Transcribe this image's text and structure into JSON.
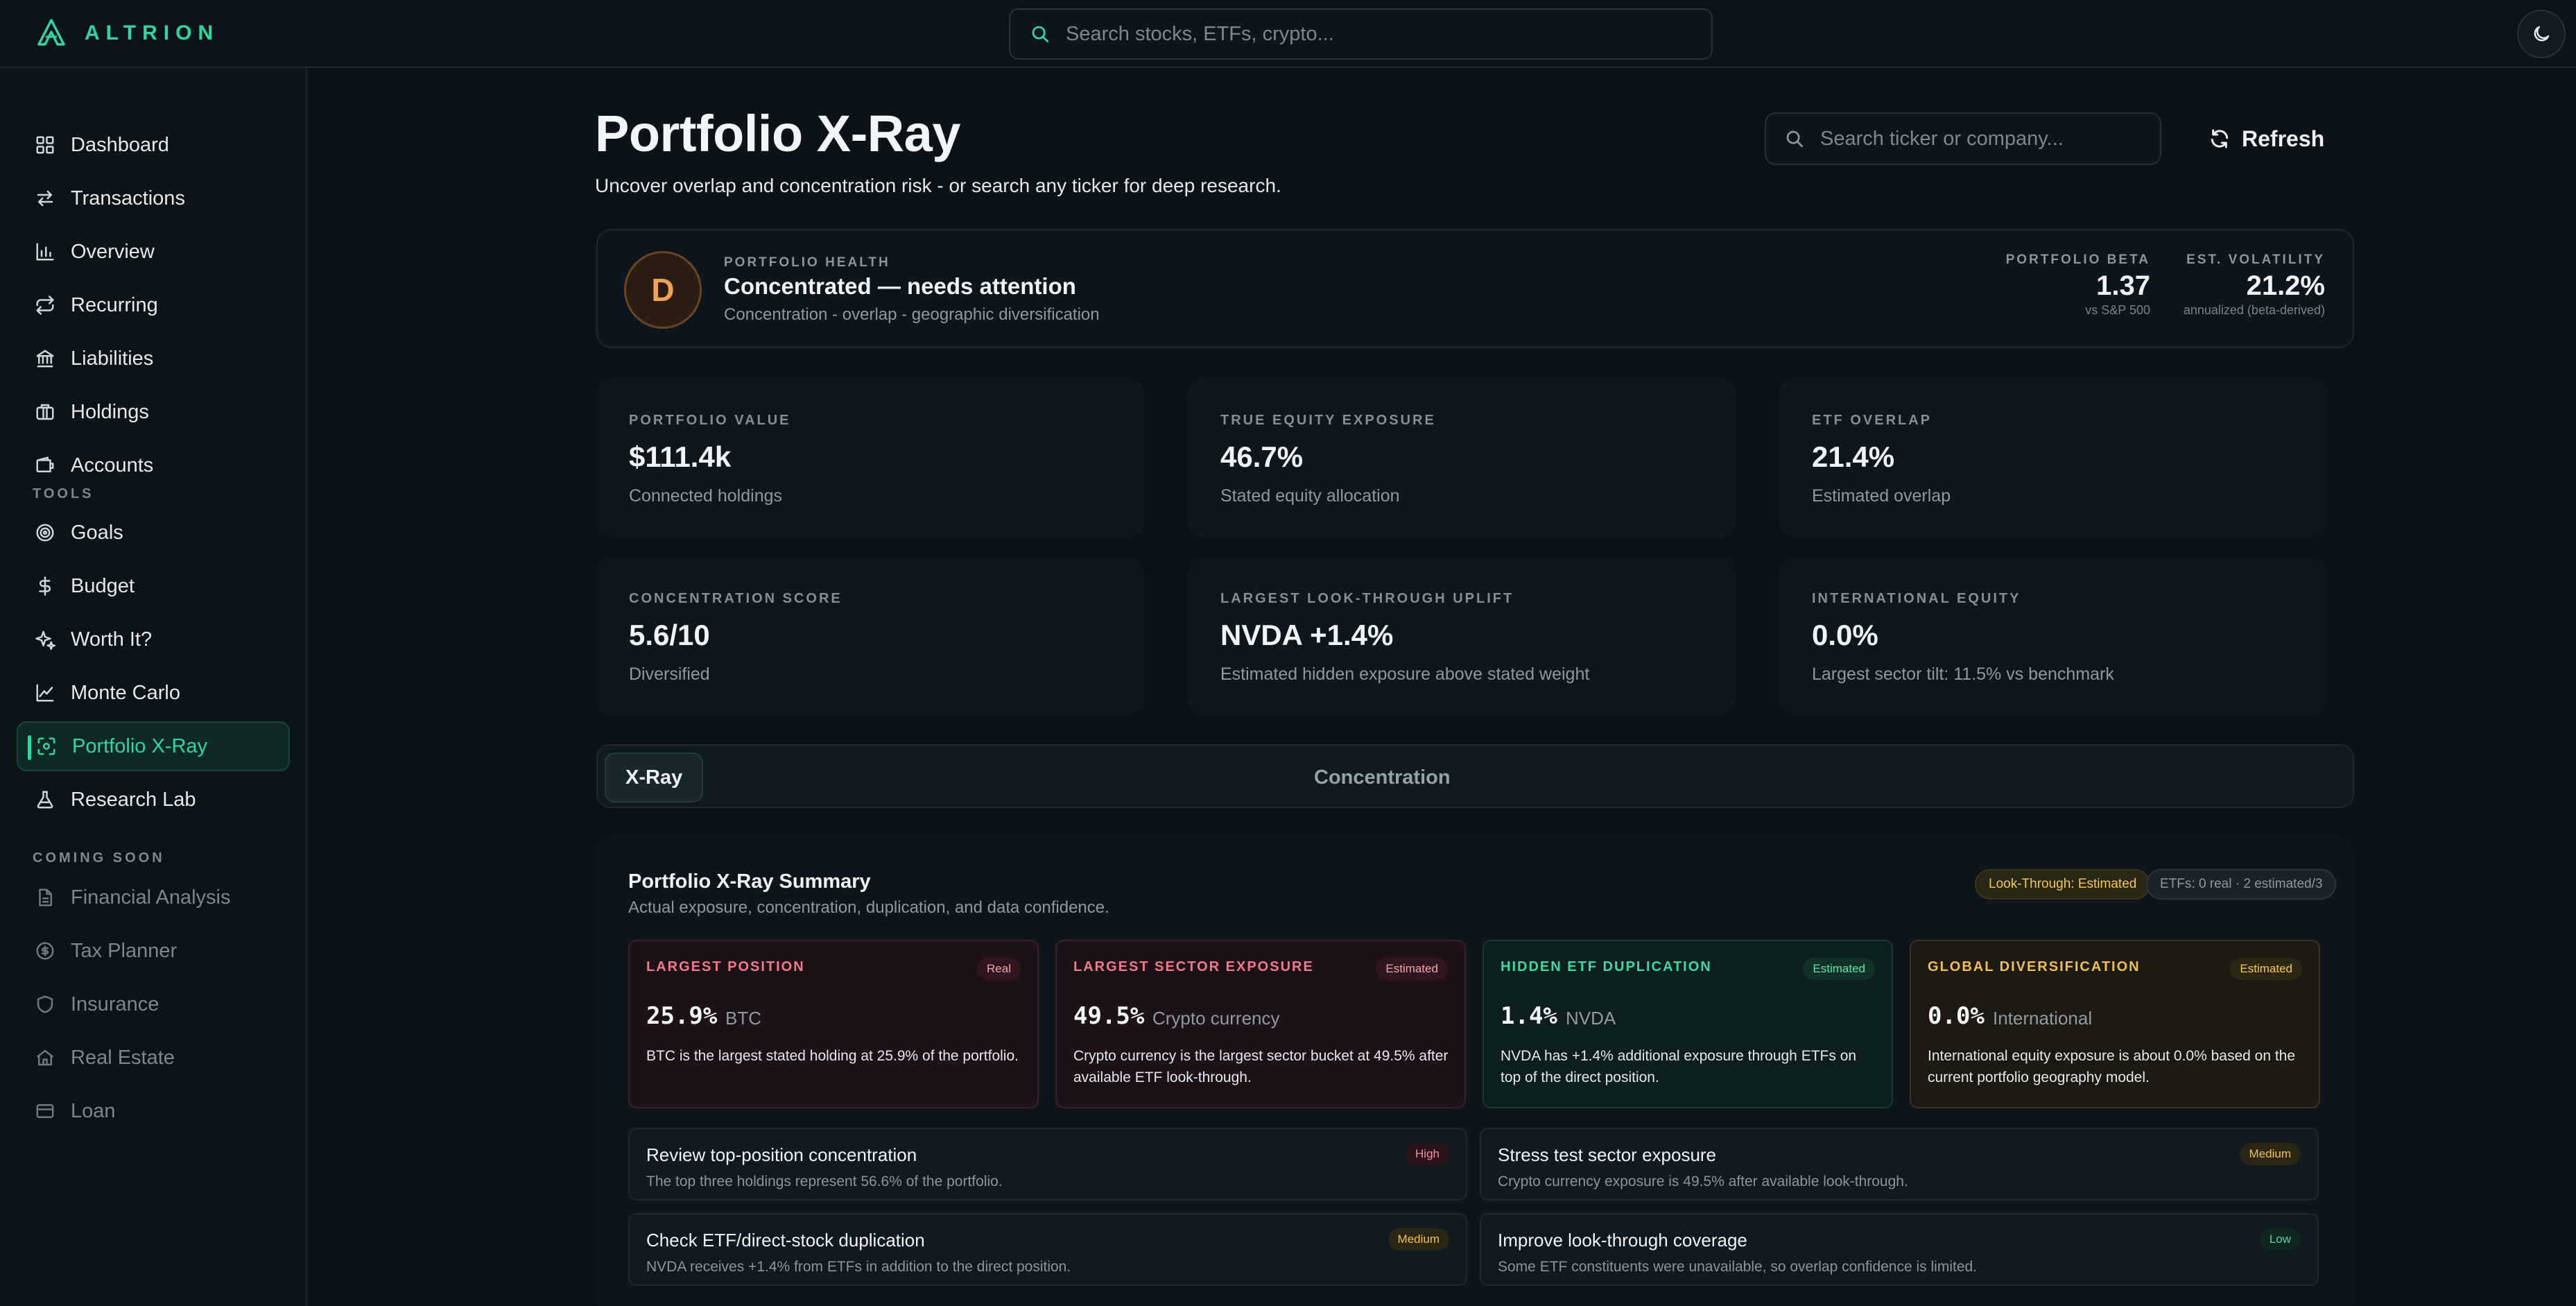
{
  "brand": {
    "name": "ALTRION"
  },
  "global_search": {
    "placeholder": "Search stocks, ETFs, crypto..."
  },
  "sidebar": {
    "items": [
      {
        "label": "Dashboard",
        "icon": "grid-icon"
      },
      {
        "label": "Transactions",
        "icon": "arrows-icon"
      },
      {
        "label": "Overview",
        "icon": "bar-chart-icon"
      },
      {
        "label": "Recurring",
        "icon": "repeat-icon"
      },
      {
        "label": "Liabilities",
        "icon": "bank-icon"
      },
      {
        "label": "Holdings",
        "icon": "briefcase-icon"
      },
      {
        "label": "Accounts",
        "icon": "wallet-icon"
      }
    ],
    "tools_heading": "TOOLS",
    "tools": [
      {
        "label": "Goals",
        "icon": "target-icon"
      },
      {
        "label": "Budget",
        "icon": "dollar-icon"
      },
      {
        "label": "Worth It?",
        "icon": "sparkle-icon"
      },
      {
        "label": "Monte Carlo",
        "icon": "line-chart-icon"
      },
      {
        "label": "Portfolio X-Ray",
        "icon": "scan-icon",
        "active": true
      },
      {
        "label": "Research Lab",
        "icon": "flask-icon"
      }
    ],
    "coming_heading": "COMING SOON",
    "coming": [
      {
        "label": "Financial Analysis",
        "icon": "file-icon"
      },
      {
        "label": "Tax Planner",
        "icon": "coin-icon"
      },
      {
        "label": "Insurance",
        "icon": "shield-icon"
      },
      {
        "label": "Real Estate",
        "icon": "home-icon"
      },
      {
        "label": "Loan",
        "icon": "card-icon"
      }
    ]
  },
  "header": {
    "title": "Portfolio X-Ray",
    "subtitle": "Uncover overlap and concentration risk - or search any ticker for deep research.",
    "ticker_search_placeholder": "Search ticker or company...",
    "refresh_label": "Refresh"
  },
  "health": {
    "grade": "D",
    "eyebrow": "PORTFOLIO HEALTH",
    "title": "Concentrated — needs attention",
    "desc": "Concentration - overlap - geographic diversification",
    "beta": {
      "label": "PORTFOLIO BETA",
      "value": "1.37",
      "sub": "vs S&P 500"
    },
    "volatility": {
      "label": "EST. VOLATILITY",
      "value": "21.2%",
      "sub": "annualized (beta-derived)"
    }
  },
  "stats": [
    {
      "label": "PORTFOLIO VALUE",
      "value": "$111.4k",
      "sub": "Connected holdings"
    },
    {
      "label": "TRUE EQUITY EXPOSURE",
      "value": "46.7%",
      "sub": "Stated equity allocation"
    },
    {
      "label": "ETF OVERLAP",
      "value": "21.4%",
      "sub": "Estimated overlap"
    },
    {
      "label": "CONCENTRATION SCORE",
      "value": "5.6/10",
      "sub": "Diversified"
    },
    {
      "label": "LARGEST LOOK-THROUGH UPLIFT",
      "value": "NVDA +1.4%",
      "sub": "Estimated hidden exposure above stated weight"
    },
    {
      "label": "INTERNATIONAL EQUITY",
      "value": "0.0%",
      "sub": "Largest sector tilt: 11.5% vs benchmark"
    }
  ],
  "tabs": [
    {
      "label": "X-Ray",
      "active": true
    },
    {
      "label": "Concentration",
      "active": false
    }
  ],
  "summary": {
    "title": "Portfolio X-Ray Summary",
    "desc": "Actual exposure, concentration, duplication, and data confidence.",
    "pill_lookthrough": "Look-Through: Estimated",
    "pill_etfs": "ETFs: 0 real · 2 estimated/3",
    "insights": [
      {
        "label": "LARGEST POSITION",
        "badge": "Real",
        "value": "25.9%",
        "unit": "BTC",
        "body": "BTC is the largest stated holding at 25.9% of the portfolio.",
        "tone": "red"
      },
      {
        "label": "LARGEST SECTOR EXPOSURE",
        "badge": "Estimated",
        "value": "49.5%",
        "unit": "Crypto currency",
        "body": "Crypto currency is the largest sector bucket at 49.5% after available ETF look-through.",
        "tone": "red"
      },
      {
        "label": "HIDDEN ETF DUPLICATION",
        "badge": "Estimated",
        "value": "1.4%",
        "unit": "NVDA",
        "body": "NVDA has +1.4% additional exposure through ETFs on top of the direct position.",
        "tone": "green"
      },
      {
        "label": "GLOBAL DIVERSIFICATION",
        "badge": "Estimated",
        "value": "0.0%",
        "unit": "International",
        "body": "International equity exposure is about 0.0% based on the current portfolio geography model.",
        "tone": "yellow"
      }
    ],
    "actions": [
      {
        "title": "Review top-position concentration",
        "desc": "The top three holdings represent 56.6% of the portfolio.",
        "level": "High"
      },
      {
        "title": "Stress test sector exposure",
        "desc": "Crypto currency exposure is 49.5% after available look-through.",
        "level": "Medium"
      },
      {
        "title": "Check ETF/direct-stock duplication",
        "desc": "NVDA receives +1.4% from ETFs in addition to the direct position.",
        "level": "Medium"
      },
      {
        "title": "Improve look-through coverage",
        "desc": "Some ETF constituents were unavailable, so overlap confidence is limited.",
        "level": "Low"
      }
    ]
  },
  "colors": {
    "accent": "#2fd6a3",
    "background": "#0b1218",
    "warning": "#f0c04e",
    "danger": "#f07a8a"
  }
}
